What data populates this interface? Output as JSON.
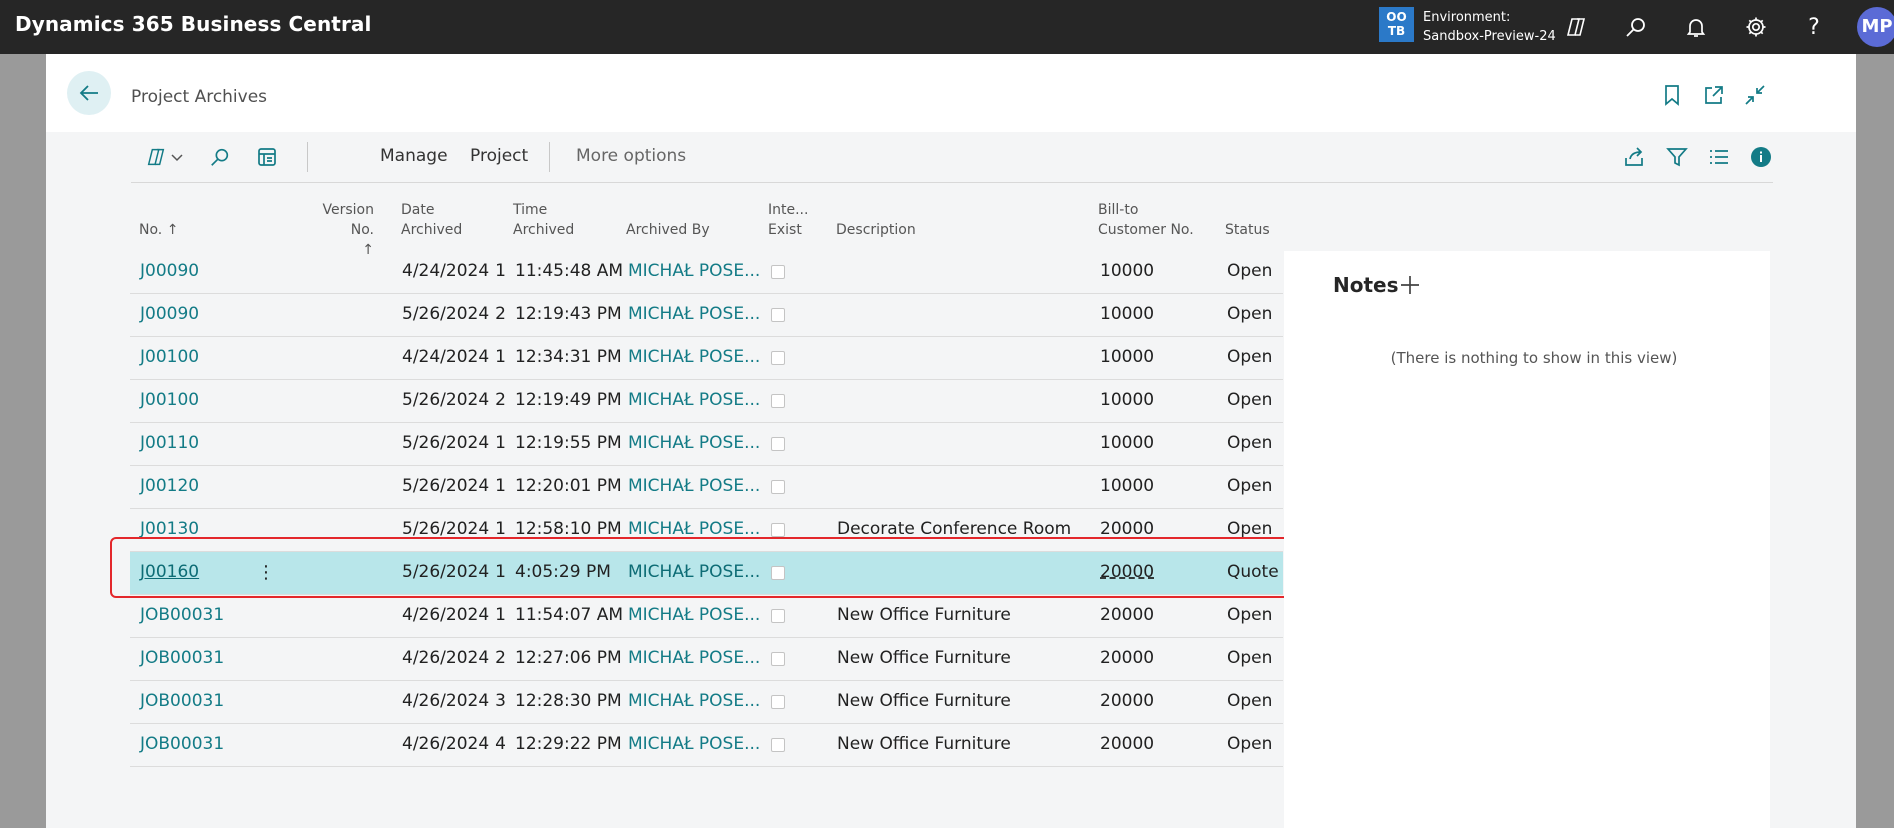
{
  "app": {
    "title": "Dynamics 365 Business Central"
  },
  "environment": {
    "badge_line1": "OO",
    "badge_line2": "TB",
    "label": "Environment:",
    "name": "Sandbox-Preview-24"
  },
  "user": {
    "initials": "MP"
  },
  "page": {
    "title": "Project Archives"
  },
  "toolbar": {
    "manage": "Manage",
    "project": "Project",
    "more": "More options"
  },
  "columns": {
    "no": "No.",
    "sort_arrow": "↑",
    "version_no": "Version No.",
    "version_sort": "↑",
    "date_archived_1": "Date",
    "date_archived_2": "Archived",
    "time_archived_1": "Time",
    "time_archived_2": "Archived",
    "archived_by": "Archived By",
    "inte_1": "Inte...",
    "inte_2": "Exist",
    "description": "Description",
    "bill_to_1": "Bill-to",
    "bill_to_2": "Customer No.",
    "status": "Status"
  },
  "rows": [
    {
      "no": "J00090",
      "version": "1",
      "date": "4/24/2024",
      "time": "11:45:48 AM",
      "by": "MICHAŁ POSE...",
      "desc": "",
      "cust": "10000",
      "status": "Open"
    },
    {
      "no": "J00090",
      "version": "2",
      "date": "5/26/2024",
      "time": "12:19:43 PM",
      "by": "MICHAŁ POSE...",
      "desc": "",
      "cust": "10000",
      "status": "Open"
    },
    {
      "no": "J00100",
      "version": "1",
      "date": "4/24/2024",
      "time": "12:34:31 PM",
      "by": "MICHAŁ POSE...",
      "desc": "",
      "cust": "10000",
      "status": "Open"
    },
    {
      "no": "J00100",
      "version": "2",
      "date": "5/26/2024",
      "time": "12:19:49 PM",
      "by": "MICHAŁ POSE...",
      "desc": "",
      "cust": "10000",
      "status": "Open"
    },
    {
      "no": "J00110",
      "version": "1",
      "date": "5/26/2024",
      "time": "12:19:55 PM",
      "by": "MICHAŁ POSE...",
      "desc": "",
      "cust": "10000",
      "status": "Open"
    },
    {
      "no": "J00120",
      "version": "1",
      "date": "5/26/2024",
      "time": "12:20:01 PM",
      "by": "MICHAŁ POSE...",
      "desc": "",
      "cust": "10000",
      "status": "Open"
    },
    {
      "no": "J00130",
      "version": "1",
      "date": "5/26/2024",
      "time": "12:58:10 PM",
      "by": "MICHAŁ POSE...",
      "desc": "Decorate Conference Room",
      "cust": "20000",
      "status": "Open"
    },
    {
      "no": "J00160",
      "version": "1",
      "date": "5/26/2024",
      "time": "4:05:29 PM",
      "by": "MICHAŁ POSE...",
      "desc": "",
      "cust": "20000",
      "status": "Quote"
    },
    {
      "no": "JOB00031",
      "version": "1",
      "date": "4/26/2024",
      "time": "11:54:07 AM",
      "by": "MICHAŁ POSE...",
      "desc": "New Office Furniture",
      "cust": "20000",
      "status": "Open"
    },
    {
      "no": "JOB00031",
      "version": "2",
      "date": "4/26/2024",
      "time": "12:27:06 PM",
      "by": "MICHAŁ POSE...",
      "desc": "New Office Furniture",
      "cust": "20000",
      "status": "Open"
    },
    {
      "no": "JOB00031",
      "version": "3",
      "date": "4/26/2024",
      "time": "12:28:30 PM",
      "by": "MICHAŁ POSE...",
      "desc": "New Office Furniture",
      "cust": "20000",
      "status": "Open"
    },
    {
      "no": "JOB00031",
      "version": "4",
      "date": "4/26/2024",
      "time": "12:29:22 PM",
      "by": "MICHAŁ POSE...",
      "desc": "New Office Furniture",
      "cust": "20000",
      "status": "Open"
    }
  ],
  "selected_row": 7,
  "row_menu_glyph": "⋮",
  "notes": {
    "title": "Notes",
    "empty": "(There is nothing to show in this view)"
  },
  "colors": {
    "accent": "#137b86",
    "selected_row": "#b8e6ea",
    "highlight_outline": "#e3272b",
    "topbar": "#262626"
  }
}
